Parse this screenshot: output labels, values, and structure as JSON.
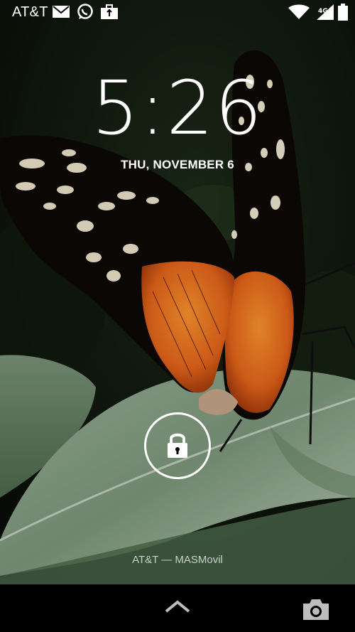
{
  "status_bar": {
    "carrier": "AT&T",
    "icons": [
      "mail-icon",
      "whatsapp-icon",
      "briefcase-icon",
      "wifi-icon",
      "signal-icon",
      "battery-icon"
    ]
  },
  "lockscreen": {
    "time": "5:26",
    "date": "THU, NOVEMBER 6",
    "owner_info": "AT&T — MASMovil",
    "lock_icon": "padlock-icon"
  },
  "navigation": {
    "up_icon": "chevron-up-icon",
    "camera_icon": "camera-icon"
  },
  "colors": {
    "wing_orange": "#e8661a",
    "wing_black": "#0c0805",
    "leaf_green": "#8ea98e",
    "background_dark": "#0b120a"
  }
}
